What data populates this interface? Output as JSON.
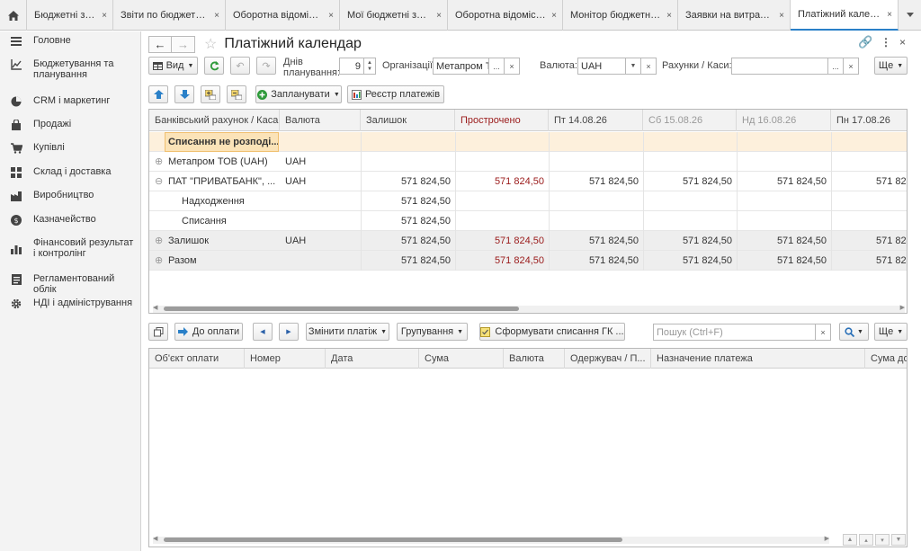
{
  "tabs": [
    {
      "label": "Бюджетні звіти",
      "close": "×"
    },
    {
      "label": "Звіти по бюджетува...",
      "close": "×"
    },
    {
      "label": "Оборотна відомість...",
      "close": "×"
    },
    {
      "label": "Мої бюджетні задачі",
      "close": "×"
    },
    {
      "label": "Оборотна відомість...",
      "close": "×"
    },
    {
      "label": "Монітор бюджетних...",
      "close": "×"
    },
    {
      "label": "Заявки на витрачан...",
      "close": "×"
    },
    {
      "label": "Платіжний календар",
      "close": "×"
    }
  ],
  "sidebar": {
    "items": [
      {
        "label": "Головне",
        "icon": "menu-icon"
      },
      {
        "label": "Бюджетування та планування",
        "icon": "chart-icon"
      },
      {
        "label": "CRM і маркетинг",
        "icon": "pie-icon"
      },
      {
        "label": "Продажі",
        "icon": "bag-icon"
      },
      {
        "label": "Купівлі",
        "icon": "cart-icon"
      },
      {
        "label": "Склад і доставка",
        "icon": "grid-icon"
      },
      {
        "label": "Виробництво",
        "icon": "factory-icon"
      },
      {
        "label": "Казначейство",
        "icon": "money-icon"
      },
      {
        "label": "Фінансовий результат і контролінг",
        "icon": "bar-icon"
      },
      {
        "label": "Регламентований облік",
        "icon": "doc-icon"
      },
      {
        "label": "НДІ і адміністрування",
        "icon": "gear-icon"
      }
    ]
  },
  "page": {
    "title": "Платіжний календар"
  },
  "toolbar": {
    "view_label": "Вид",
    "days_label": "Днів\nпланування:",
    "days_value": "9",
    "org_label": "Організації:",
    "org_value": "Метапром Т",
    "currency_label": "Валюта:",
    "currency_value": "UAH",
    "accounts_label": "Рахунки / Каси:",
    "accounts_value": "",
    "more_label": "Ще",
    "dots": "...",
    "clear": "×",
    "plan_label": "Запланувати",
    "registry_label": "Реєстр платежів"
  },
  "grid1": {
    "headers": [
      "Банківський рахунок / Каса",
      "Валюта",
      "Залишок",
      "Прострочено",
      "Пт 14.08.26",
      "Сб 15.08.26",
      "Нд 16.08.26",
      "Пн 17.08.26"
    ],
    "rows": [
      {
        "name": "Списання не розподі...",
        "currency": "",
        "vals": [
          "",
          "",
          "",
          "",
          "",
          "",
          ""
        ]
      },
      {
        "name": "Метапром ТОВ (UAH)",
        "currency": "UAH",
        "vals": [
          "",
          "",
          "",
          "",
          "",
          "",
          ""
        ]
      },
      {
        "name": "ПАТ \"ПРИВАТБАНК\", ...",
        "currency": "UAH",
        "vals": [
          "571 824,50",
          "571 824,50",
          "571 824,50",
          "571 824,50",
          "571 824,50",
          "571 824"
        ]
      },
      {
        "name": "Надходження",
        "currency": "",
        "vals": [
          "571 824,50",
          "",
          "",
          "",
          "",
          ""
        ]
      },
      {
        "name": "Списання",
        "currency": "",
        "vals": [
          "571 824,50",
          "",
          "",
          "",
          "",
          ""
        ]
      },
      {
        "name": "Залишок",
        "currency": "UAH",
        "vals": [
          "571 824,50",
          "571 824,50",
          "571 824,50",
          "571 824,50",
          "571 824,50",
          "571 824"
        ]
      },
      {
        "name": "Разом",
        "currency": "",
        "vals": [
          "571 824,50",
          "571 824,50",
          "571 824,50",
          "571 824,50",
          "571 824,50",
          "571 824"
        ]
      }
    ]
  },
  "toolbar2": {
    "pay_label": "До оплати",
    "change_label": "Змінити платіж",
    "group_label": "Групування",
    "form_label": "Сформувати списання ГК ...",
    "search_placeholder": "Пошук (Ctrl+F)",
    "more_label": "Ще"
  },
  "grid2": {
    "headers": [
      "Об'єкт оплати",
      "Номер",
      "Дата",
      "Сума",
      "Валюта",
      "Одержувач / П...",
      "Назначение платежа",
      "Сума до"
    ]
  }
}
